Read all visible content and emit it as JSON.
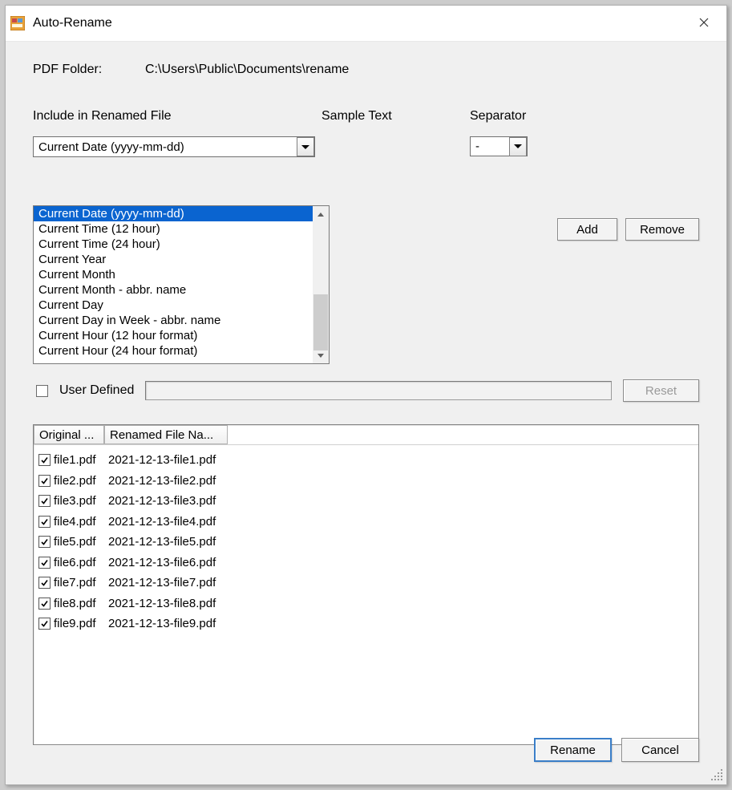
{
  "window": {
    "title": "Auto-Rename"
  },
  "folder": {
    "label": "PDF Folder:",
    "path": "C:\\Users\\Public\\Documents\\rename"
  },
  "headers": {
    "include": "Include in Renamed File",
    "sample": "Sample Text",
    "separator": "Separator"
  },
  "combo": {
    "selected": "Current Date (yyyy-mm-dd)"
  },
  "separator": {
    "value": "-"
  },
  "buttons": {
    "add": "Add",
    "remove": "Remove",
    "reset": "Reset",
    "rename": "Rename",
    "cancel": "Cancel"
  },
  "listItems": [
    "Current Date (yyyy-mm-dd)",
    "Current Time (12 hour)",
    "Current Time (24 hour)",
    "Current Year",
    "Current Month",
    "Current Month - abbr. name",
    "Current Day",
    "Current Day in Week - abbr. name",
    "Current Hour (12 hour format)",
    "Current Hour (24 hour format)"
  ],
  "userDefined": {
    "label": "User Defined"
  },
  "table": {
    "colOriginal": "Original ...",
    "colRenamed": "Renamed File Na...",
    "rows": [
      {
        "checked": true,
        "original": "file1.pdf",
        "renamed": "2021-12-13-file1.pdf"
      },
      {
        "checked": true,
        "original": "file2.pdf",
        "renamed": "2021-12-13-file2.pdf"
      },
      {
        "checked": true,
        "original": "file3.pdf",
        "renamed": "2021-12-13-file3.pdf"
      },
      {
        "checked": true,
        "original": "file4.pdf",
        "renamed": "2021-12-13-file4.pdf"
      },
      {
        "checked": true,
        "original": "file5.pdf",
        "renamed": "2021-12-13-file5.pdf"
      },
      {
        "checked": true,
        "original": "file6.pdf",
        "renamed": "2021-12-13-file6.pdf"
      },
      {
        "checked": true,
        "original": "file7.pdf",
        "renamed": "2021-12-13-file7.pdf"
      },
      {
        "checked": true,
        "original": "file8.pdf",
        "renamed": "2021-12-13-file8.pdf"
      },
      {
        "checked": true,
        "original": "file9.pdf",
        "renamed": "2021-12-13-file9.pdf"
      }
    ]
  }
}
